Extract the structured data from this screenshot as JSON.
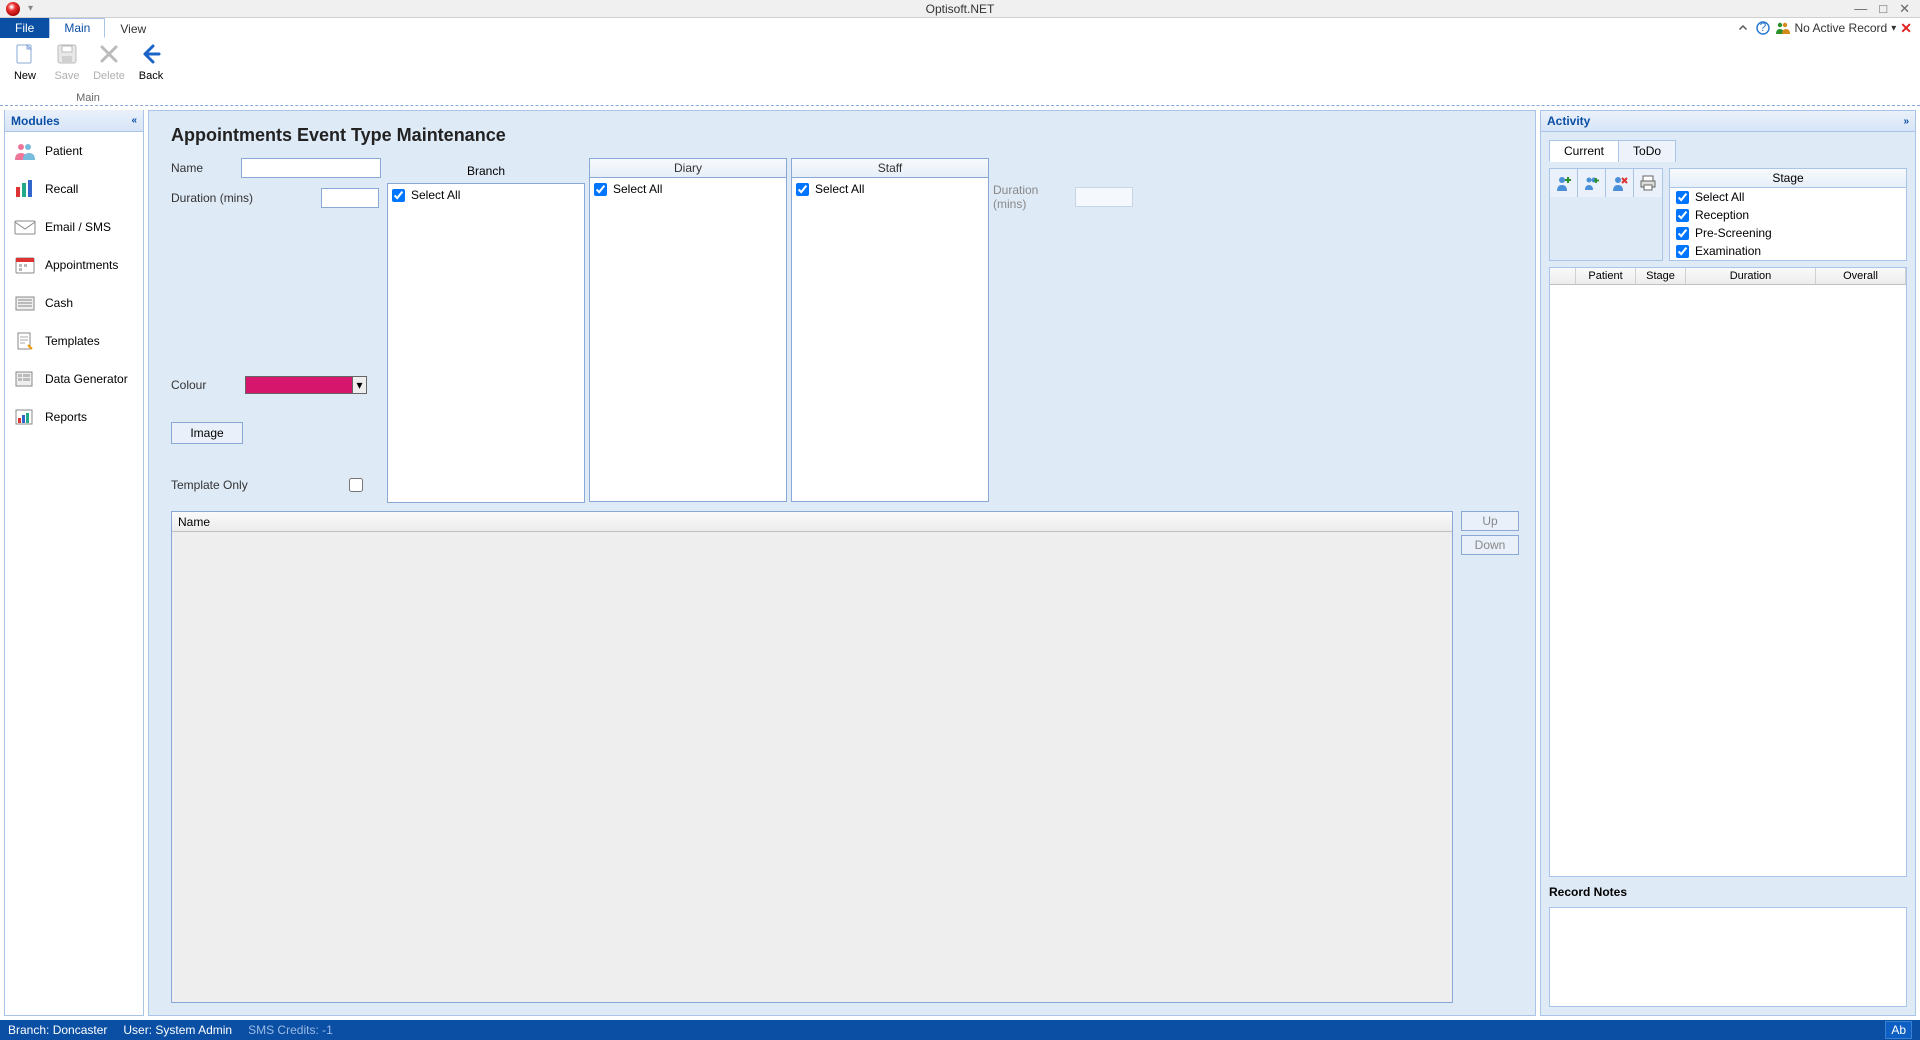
{
  "app": {
    "title": "Optisoft.NET"
  },
  "ribbonTabs": {
    "file": "File",
    "main": "Main",
    "view": "View"
  },
  "recordStatus": "No Active Record",
  "ribbon": {
    "group": "Main",
    "new": "New",
    "save": "Save",
    "delete": "Delete",
    "back": "Back"
  },
  "modules": {
    "title": "Modules",
    "items": [
      {
        "label": "Patient"
      },
      {
        "label": "Recall"
      },
      {
        "label": "Email / SMS"
      },
      {
        "label": "Appointments"
      },
      {
        "label": "Cash"
      },
      {
        "label": "Templates"
      },
      {
        "label": "Data Generator"
      },
      {
        "label": "Reports"
      }
    ]
  },
  "content": {
    "heading": "Appointments Event Type Maintenance",
    "labels": {
      "name": "Name",
      "branch": "Branch",
      "diary": "Diary",
      "staff": "Staff",
      "duration": "Duration (mins)",
      "durationRight": "Duration (mins)",
      "selectAll": "Select All",
      "colour": "Colour",
      "image": "Image",
      "templateOnly": "Template Only"
    },
    "branchSelectAll": true,
    "diarySelectAll": true,
    "staffSelectAll": true,
    "colourHex": "#d6156c",
    "listHeader": "Name",
    "up": "Up",
    "down": "Down"
  },
  "activity": {
    "title": "Activity",
    "tabs": {
      "current": "Current",
      "todo": "ToDo"
    },
    "stageTitle": "Stage",
    "stages": [
      {
        "label": "Select All",
        "checked": true
      },
      {
        "label": "Reception",
        "checked": true
      },
      {
        "label": "Pre-Screening",
        "checked": true
      },
      {
        "label": "Examination",
        "checked": true
      }
    ],
    "columns": {
      "patient": "Patient",
      "stage": "Stage",
      "duration": "Duration",
      "overall": "Overall"
    },
    "notesTitle": "Record Notes"
  },
  "status": {
    "branch": "Branch: Doncaster",
    "user": "User: System Admin",
    "sms": "SMS Credits: -1",
    "ab": "Ab"
  }
}
